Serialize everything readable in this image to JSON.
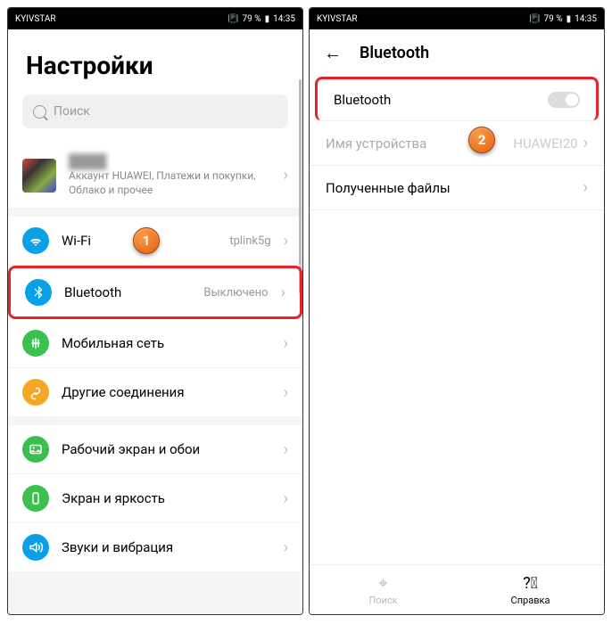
{
  "statusbar": {
    "carrier": "KYIVSTAR",
    "battery": "79 %",
    "time": "14:35"
  },
  "left": {
    "title": "Настройки",
    "search_placeholder": "Поиск",
    "account_sub": "Аккаунт HUAWEI, Платежи и покупки, Облако и прочее",
    "items": [
      {
        "label": "Wi-Fi",
        "value": "tplink5g"
      },
      {
        "label": "Bluetooth",
        "value": "Выключено"
      },
      {
        "label": "Мобильная сеть",
        "value": ""
      },
      {
        "label": "Другие соединения",
        "value": ""
      }
    ],
    "section2": [
      {
        "label": "Рабочий экран и обои"
      },
      {
        "label": "Экран и яркость"
      },
      {
        "label": "Звуки и вибрация"
      }
    ]
  },
  "right": {
    "header": "Bluetooth",
    "rows": {
      "toggle_label": "Bluetooth",
      "device_name_label": "Имя устройства",
      "device_name_value": "HUAWEI20",
      "files_label": "Полученные файлы"
    },
    "nav": {
      "search": "Поиск",
      "help": "Справка"
    }
  },
  "markers": {
    "one": "1",
    "two": "2"
  }
}
